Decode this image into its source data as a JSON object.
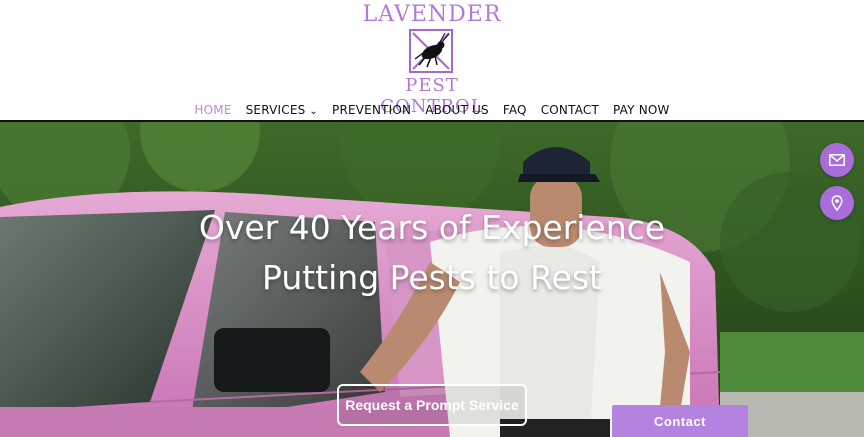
{
  "brand": {
    "name_top": "LAVENDER",
    "name_bottom": "PEST CONTROL",
    "logo_icon": "cricket-in-crossed-box-icon",
    "color": "#b07ad6"
  },
  "nav": {
    "items": [
      {
        "label": "HOME",
        "active": true
      },
      {
        "label": "SERVICES",
        "active": false,
        "has_dropdown": true
      },
      {
        "label": "PREVENTION",
        "active": false
      },
      {
        "label": "ABOUT US",
        "active": false
      },
      {
        "label": "FAQ",
        "active": false
      },
      {
        "label": "CONTACT",
        "active": false
      },
      {
        "label": "PAY NOW",
        "active": false
      }
    ],
    "active_color": "#b58ad7"
  },
  "hero": {
    "headline_line1": "Over 40 Years of Experience",
    "headline_line2": "Putting Pests to Rest",
    "cta_label": "Request a Prompt Service"
  },
  "floating": {
    "email_icon": "envelope-icon",
    "location_icon": "map-pin-icon",
    "color": "#a86cdb"
  },
  "contact_tab": {
    "label": "Contact",
    "color": "#b483e0"
  }
}
